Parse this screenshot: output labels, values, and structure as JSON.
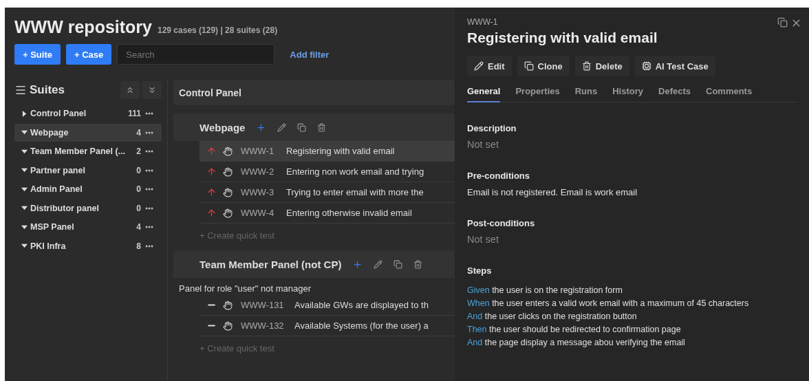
{
  "header": {
    "title": "WWW repository",
    "stats": "129 cases (129) | 28 suites (28)",
    "buttons": [
      "+ Suite",
      "+ Case"
    ],
    "search": {
      "placeholder": "Search"
    },
    "filter_link": "Add filter"
  },
  "sidebar": {
    "title": "Suites",
    "items": [
      {
        "label": "Control Panel",
        "count": "111",
        "expanded": false,
        "selected": false
      },
      {
        "label": "Webpage",
        "count": "4",
        "expanded": true,
        "selected": true
      },
      {
        "label": "Team Member Panel (...",
        "count": "2",
        "expanded": true,
        "selected": false
      },
      {
        "label": "Partner panel",
        "count": "0",
        "expanded": true,
        "selected": false
      },
      {
        "label": "Admin Panel",
        "count": "0",
        "expanded": true,
        "selected": false
      },
      {
        "label": "Distributor panel",
        "count": "0",
        "expanded": true,
        "selected": false
      },
      {
        "label": "MSP Panel",
        "count": "4",
        "expanded": true,
        "selected": false
      },
      {
        "label": "PKI Infra",
        "count": "8",
        "expanded": true,
        "selected": false
      }
    ]
  },
  "content": {
    "parent_suite": "Control Panel",
    "suites": [
      {
        "title": "Webpage",
        "cases": [
          {
            "kind": "high",
            "id": "WWW-1",
            "title": "Registering with valid email",
            "selected": true
          },
          {
            "kind": "high",
            "id": "WWW-2",
            "title": "Entering non work email and trying",
            "selected": false
          },
          {
            "kind": "high",
            "id": "WWW-3",
            "title": "Trying to enter email with more the",
            "selected": false
          },
          {
            "kind": "high",
            "id": "WWW-4",
            "title": "Entering otherwise invalid email",
            "selected": false
          }
        ],
        "quick_test": "+ Create quick test"
      },
      {
        "title": "Team Member Panel (not CP)",
        "description": "Panel for role \"user\" not manager",
        "cases": [
          {
            "kind": "none",
            "id": "WWW-131",
            "title": "Available GWs are displayed to th",
            "selected": false
          },
          {
            "kind": "none",
            "id": "WWW-132",
            "title": "Available Systems (for the user) a",
            "selected": false
          }
        ],
        "quick_test": "+ Create quick test"
      }
    ]
  },
  "detail": {
    "id": "WWW-1",
    "title": "Registering with valid email",
    "actions": [
      {
        "kind": "edit",
        "label": "Edit"
      },
      {
        "kind": "clone",
        "label": "Clone"
      },
      {
        "kind": "delete",
        "label": "Delete"
      },
      {
        "kind": "ai",
        "label": "AI Test Case"
      }
    ],
    "tabs": [
      {
        "label": "General",
        "selected": true
      },
      {
        "label": "Properties",
        "selected": false
      },
      {
        "label": "Runs",
        "selected": false
      },
      {
        "label": "History",
        "selected": false
      },
      {
        "label": "Defects",
        "selected": false
      },
      {
        "label": "Comments",
        "selected": false
      }
    ],
    "sections": [
      {
        "heading": "Description",
        "value": "Not set",
        "set": false
      },
      {
        "heading": "Pre-conditions",
        "value": "Email is not registered. Email is work email",
        "set": true
      },
      {
        "heading": "Post-conditions",
        "value": "Not set",
        "set": false
      }
    ],
    "steps_heading": "Steps",
    "steps": [
      {
        "keyword": "Given",
        "text": "the user is on the registration form"
      },
      {
        "keyword": "When",
        "text": "the user enters a valid work email with a maximum of 45 characters"
      },
      {
        "keyword": "And",
        "text": "the user clicks on the registration button"
      },
      {
        "keyword": "Then",
        "text": "the user should be redirected to confirmation page"
      },
      {
        "keyword": "And",
        "text": "the page display a message abou verifying the email"
      }
    ]
  }
}
